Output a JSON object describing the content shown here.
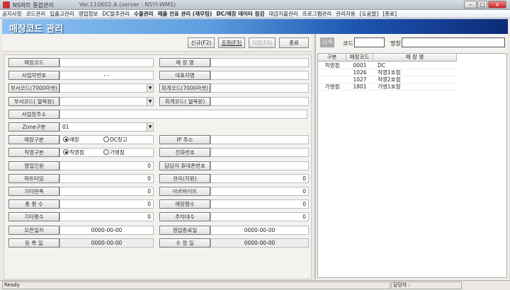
{
  "window": {
    "title": "NS마트 통합관리",
    "version": "Ver.110602.A (server : NSYI-WMS)",
    "minimize": "–",
    "maximize": "□",
    "close": "x"
  },
  "menu": [
    "공지사항",
    "코드관리",
    "입출고관리",
    "영업정보",
    "DC발주관리",
    "수불관리",
    "매출 전표 관리 (재무팀)",
    "DC/매장 데이터 점검",
    "대금지불관리",
    "프로그램관리",
    "관리자용",
    "[도움말]",
    "[종료]"
  ],
  "page_title": "매장코드 관리",
  "toolbar": {
    "new": "신규(F2)",
    "search": "조회(F3)",
    "save": "저장(F4)",
    "close": "종료"
  },
  "form": {
    "store_code": {
      "label": "매장코드",
      "value": ""
    },
    "store_name": {
      "label": "매 장 명",
      "value": ""
    },
    "biz_no": {
      "label": "사업자번호",
      "value": "- -"
    },
    "ceo": {
      "label": "대표자명",
      "value": ""
    },
    "dept_7000": {
      "label": "부서코드(7000마켓)",
      "value": ""
    },
    "acct_7000": {
      "label": "회계코드(7000마켓)",
      "value": ""
    },
    "dept_yeol": {
      "label": "부서코드( 열목원)",
      "value": ""
    },
    "acct_yeol": {
      "label": "회계코드( 열목원)",
      "value": ""
    },
    "address": {
      "label": "사업장주소",
      "value": ""
    },
    "zone": {
      "label": "Zone구분",
      "value": "01"
    },
    "store_type": {
      "label": "매장구분",
      "options": [
        "매장",
        "DC창고"
      ],
      "selected": "매장"
    },
    "ip": {
      "label": "IP 주소",
      "value": ""
    },
    "direct_type": {
      "label": "직영구분",
      "options": [
        "직영점",
        "가맹점"
      ],
      "selected": "직영점"
    },
    "phone": {
      "label": "전화번호",
      "value": ""
    },
    "sales_staff": {
      "label": "영업인원",
      "value": "0"
    },
    "mobile": {
      "label": "담당자 휴대폰번호",
      "value": ""
    },
    "part_time": {
      "label": "파트타임",
      "value": "0"
    },
    "manage": {
      "label": "관리(지원)",
      "value": "0"
    },
    "other_seller": {
      "label": "기타판촉",
      "value": "0"
    },
    "arbeit": {
      "label": "아르바이트",
      "value": "0"
    },
    "total_area": {
      "label": "총 평 수",
      "value": "0"
    },
    "store_area": {
      "label": "매장평수",
      "value": "0"
    },
    "other_area": {
      "label": "기타평수",
      "value": "0"
    },
    "parking": {
      "label": "주차대수",
      "value": "0"
    },
    "open_date": {
      "label": "오픈일자",
      "value": "0000-00-00"
    },
    "close_date": {
      "label": "영업종료일",
      "value": "0000-00-00"
    },
    "reg_date": {
      "label": "등 록 일",
      "value": "0000-00-00"
    },
    "mod_date": {
      "label": "수 정 일",
      "value": "0000-00-00"
    }
  },
  "search": {
    "button": "검색",
    "code_label": "코드",
    "code_value": "",
    "name_label": "명칭",
    "name_value": ""
  },
  "table": {
    "headers": [
      "구분",
      "매장코드",
      "매 장 명"
    ],
    "rows": [
      [
        "직영점",
        "0001",
        "DC"
      ],
      [
        "",
        "1026",
        "직영1호점"
      ],
      [
        "",
        "1027",
        "직영2호점"
      ],
      [
        "가맹점",
        "1801",
        "가맹1호점"
      ]
    ]
  },
  "status": {
    "text": "Ready",
    "manager_label": "담당자 :"
  }
}
